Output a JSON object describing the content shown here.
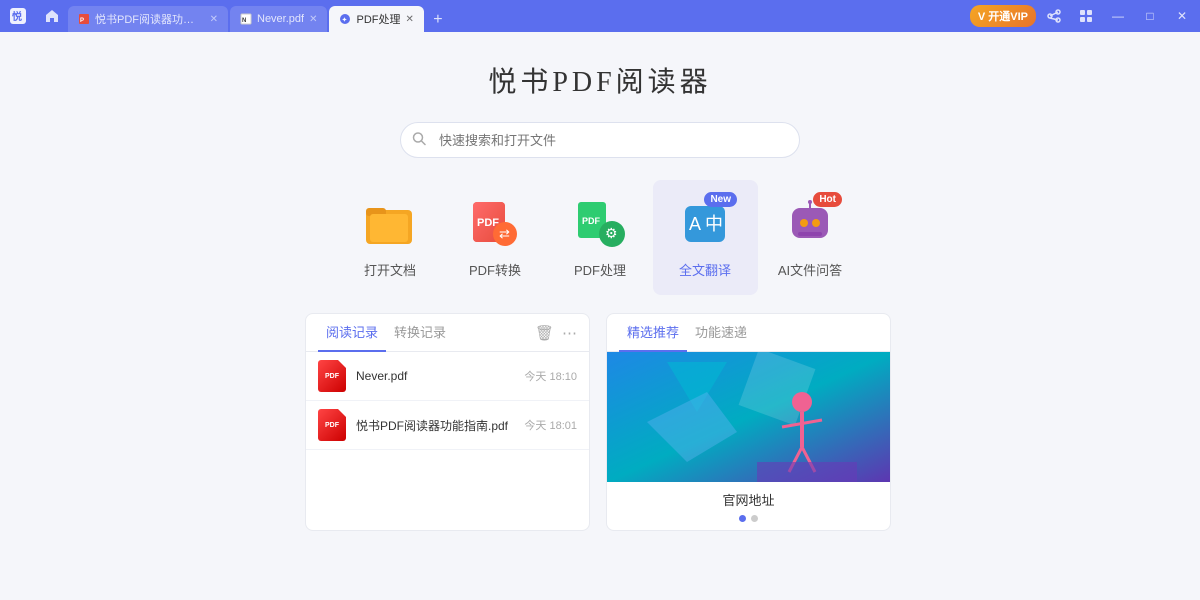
{
  "app": {
    "title": "悦书PDF阅读器",
    "search_placeholder": "快速搜索和打开文件"
  },
  "titlebar": {
    "tabs": [
      {
        "label": "悦书PDF阅读器功能指...",
        "active": false,
        "icon": "pdf"
      },
      {
        "label": "Never.pdf",
        "active": false,
        "icon": "pdf"
      },
      {
        "label": "PDF处理",
        "active": true,
        "icon": "star"
      }
    ],
    "add_tab": "+",
    "vip_label": "V 开通VIP",
    "window_controls": [
      "－",
      "□",
      "×"
    ]
  },
  "features": [
    {
      "id": "open",
      "label": "打开文档",
      "icon": "folder",
      "badge": null
    },
    {
      "id": "convert",
      "label": "PDF转换",
      "icon": "pdf-convert",
      "badge": null
    },
    {
      "id": "process",
      "label": "PDF处理",
      "icon": "pdf-process",
      "badge": null
    },
    {
      "id": "translate",
      "label": "全文翻译",
      "icon": "translate",
      "badge": "New",
      "badge_type": "new",
      "active": true
    },
    {
      "id": "ai",
      "label": "AI文件问答",
      "icon": "ai-chat",
      "badge": "Hot",
      "badge_type": "hot"
    }
  ],
  "records": {
    "tabs": [
      {
        "label": "阅读记录",
        "active": true
      },
      {
        "label": "转换记录",
        "active": false
      }
    ],
    "items": [
      {
        "name": "Never.pdf",
        "time": "今天 18:10"
      },
      {
        "name": "悦书PDF阅读器功能指南.pdf",
        "time": "今天 18:01"
      }
    ]
  },
  "recommend": {
    "tabs": [
      {
        "label": "精选推荐",
        "active": true
      },
      {
        "label": "功能速递",
        "active": false
      }
    ],
    "featured_title": "官网地址",
    "dots": [
      true,
      false
    ]
  },
  "colors": {
    "accent": "#5b6eee",
    "titlebar": "#5b6eee",
    "vip": "#f5a623"
  }
}
